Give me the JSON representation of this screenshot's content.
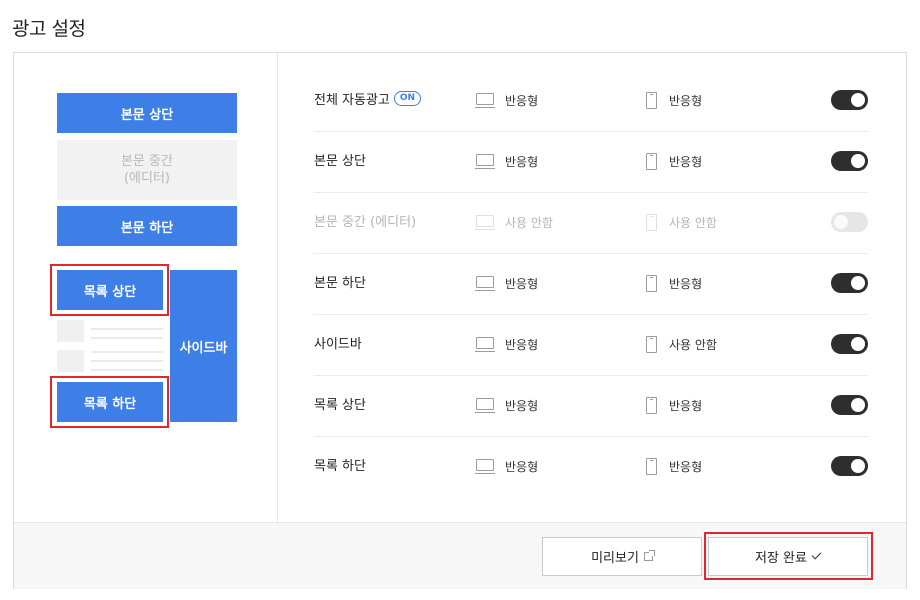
{
  "page": {
    "title": "광고 설정"
  },
  "preview": {
    "body_top": "본문 상단",
    "body_middle_line1": "본문 중간",
    "body_middle_line2": "(에디터)",
    "body_bottom": "본문 하단",
    "list_top": "목록 상단",
    "list_bottom": "목록 하단",
    "sidebar": "사이드바"
  },
  "rows": [
    {
      "label": "전체 자동광고",
      "badge": "ON",
      "pc": "반응형",
      "mobile": "반응형",
      "enabled": true
    },
    {
      "label": "본문 상단",
      "pc": "반응형",
      "mobile": "반응형",
      "enabled": true
    },
    {
      "label": "본문 중간 (에디터)",
      "pc": "사용 안함",
      "mobile": "사용 안함",
      "enabled": false
    },
    {
      "label": "본문 하단",
      "pc": "반응형",
      "mobile": "반응형",
      "enabled": true
    },
    {
      "label": "사이드바",
      "pc": "반응형",
      "mobile": "사용 안함",
      "enabled": true
    },
    {
      "label": "목록 상단",
      "pc": "반응형",
      "mobile": "반응형",
      "enabled": true
    },
    {
      "label": "목록 하단",
      "pc": "반응형",
      "mobile": "반응형",
      "enabled": true
    }
  ],
  "footer": {
    "preview_label": "미리보기",
    "save_label": "저장 완료"
  },
  "colors": {
    "accent": "#3d7fe6",
    "highlight": "#e0262f",
    "toggle_on": "#2e2e2e"
  }
}
